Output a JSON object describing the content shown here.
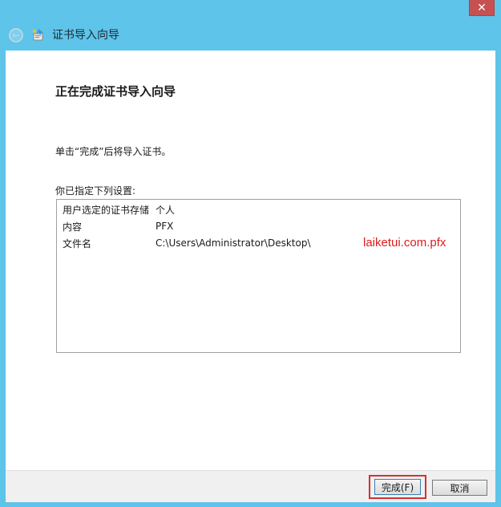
{
  "window": {
    "close_glyph": "✕",
    "title": "证书导入向导"
  },
  "page": {
    "heading": "正在完成证书导入向导",
    "description": "单击“完成”后将导入证书。",
    "settings_label": "你已指定下列设置:",
    "settings": [
      {
        "key": "用户选定的证书存储",
        "value": "个人"
      },
      {
        "key": "内容",
        "value": "PFX"
      },
      {
        "key": "文件名",
        "value": "C:\\Users\\Administrator\\Desktop\\"
      }
    ],
    "annotation": "laiketui.com.pfx"
  },
  "footer": {
    "finish_label": "完成(F)",
    "cancel_label": "取消"
  },
  "colors": {
    "frame": "#5ec4e9",
    "highlight": "#d63030",
    "annotation": "#e01b1b"
  }
}
